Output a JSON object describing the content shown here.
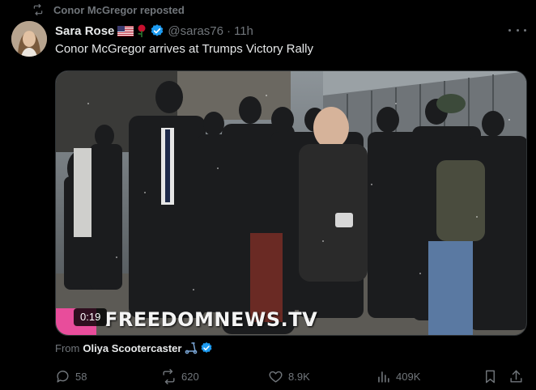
{
  "repost": {
    "text": "Conor McGregor reposted"
  },
  "author": {
    "name": "Sara Rose",
    "handle": "@saras76",
    "time": "11h"
  },
  "tweet": {
    "text": "Conor McGregor arrives at Trumps Victory Rally"
  },
  "media": {
    "duration": "0:19",
    "watermark": "FREEDOMNEWS.TV"
  },
  "attribution": {
    "label": "From",
    "source": "Oliya Scootercaster"
  },
  "actions": {
    "replies": "58",
    "reposts": "620",
    "likes": "8.9K",
    "views": "409K"
  },
  "colors": {
    "background": "#000000",
    "text": "#e7e9ea",
    "muted": "#71767b",
    "verified": "#1d9bf0",
    "watermark_bar": "#e84d9b"
  },
  "icons": [
    "repost-icon",
    "us-flag-icon",
    "rose-icon",
    "verified-badge-icon",
    "more-icon",
    "kick-scooter-icon",
    "reply-icon",
    "like-icon",
    "views-icon",
    "bookmark-icon",
    "share-icon"
  ]
}
